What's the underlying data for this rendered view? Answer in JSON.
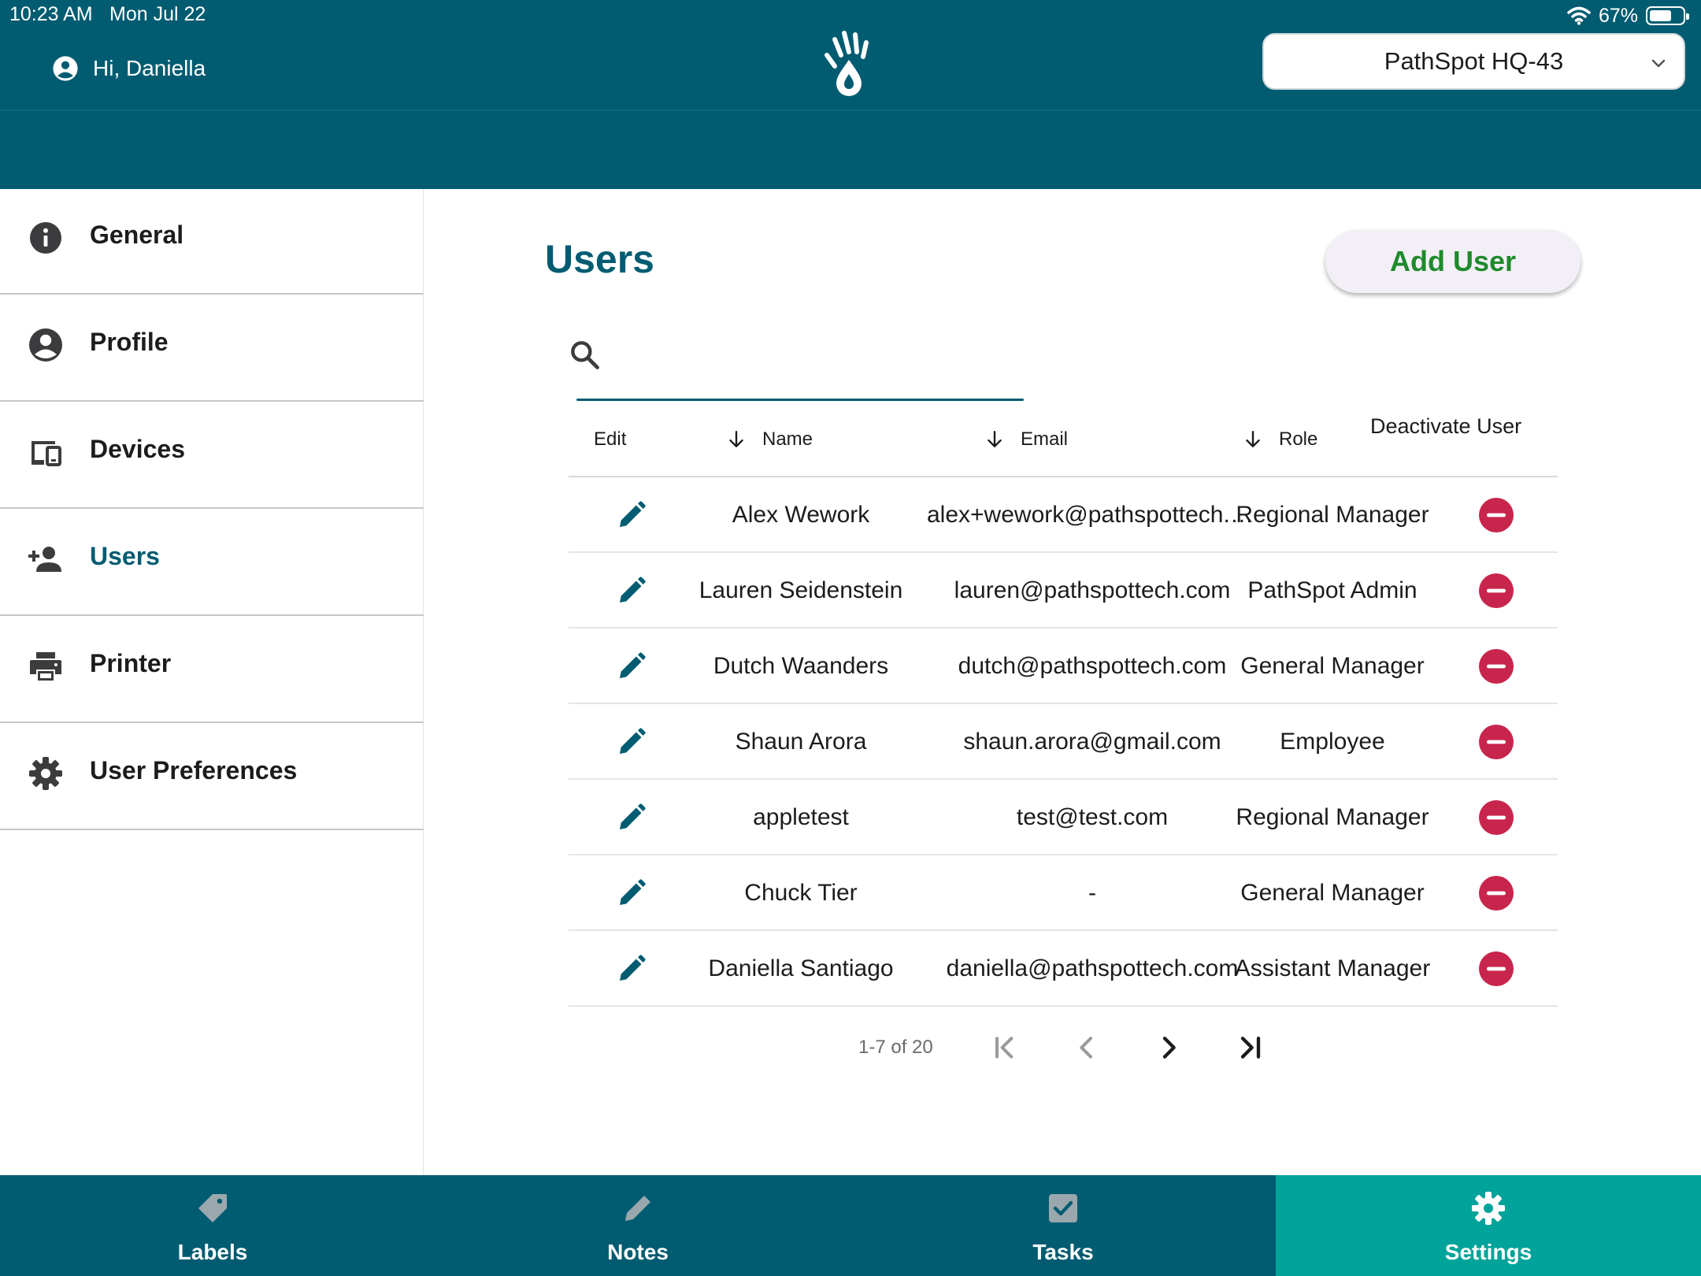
{
  "status_bar": {
    "time": "10:23 AM",
    "date": "Mon Jul 22",
    "battery": "67%",
    "battery_level": 0.67
  },
  "header": {
    "greeting": "Hi, Daniella",
    "location": "PathSpot HQ-43"
  },
  "colors": {
    "primary": "#015c71",
    "accent": "#00a39a",
    "add_user_text": "#1e8a2c",
    "deactivate": "#c8254d"
  },
  "sidebar": {
    "items": [
      {
        "label": "General",
        "icon": "info-icon",
        "active": false
      },
      {
        "label": "Profile",
        "icon": "account-circle-icon",
        "active": false
      },
      {
        "label": "Devices",
        "icon": "devices-icon",
        "active": false
      },
      {
        "label": "Users",
        "icon": "person-add-icon",
        "active": true
      },
      {
        "label": "Printer",
        "icon": "printer-icon",
        "active": false
      },
      {
        "label": "User Preferences",
        "icon": "gear-icon",
        "active": false
      }
    ]
  },
  "main": {
    "title": "Users",
    "add_user_label": "Add User",
    "search": {
      "placeholder": "",
      "value": ""
    },
    "table": {
      "headers": {
        "edit": "Edit",
        "name": "Name",
        "email": "Email",
        "role": "Role",
        "deactivate": "Deactivate User"
      },
      "rows": [
        {
          "name": "Alex Wework",
          "email": "alex+wework@pathspottech.com",
          "role": "Regional Manager"
        },
        {
          "name": "Lauren Seidenstein",
          "email": "lauren@pathspottech.com",
          "role": "PathSpot Admin"
        },
        {
          "name": "Dutch Waanders",
          "email": "dutch@pathspottech.com",
          "role": "General Manager"
        },
        {
          "name": "Shaun Arora",
          "email": "shaun.arora@gmail.com",
          "role": "Employee"
        },
        {
          "name": "appletest",
          "email": "test@test.com",
          "role": "Regional Manager"
        },
        {
          "name": "Chuck Tier",
          "email": "-",
          "role": "General Manager"
        },
        {
          "name": "Daniella Santiago",
          "email": "daniella@pathspottech.com",
          "role": "Assistant Manager"
        }
      ]
    },
    "pagination": {
      "range": "1-7 of 20"
    }
  },
  "bottom_nav": {
    "tabs": [
      {
        "label": "Labels",
        "icon": "tag-icon",
        "active": false
      },
      {
        "label": "Notes",
        "icon": "pencil-icon",
        "active": false
      },
      {
        "label": "Tasks",
        "icon": "checkbox-icon",
        "active": false
      },
      {
        "label": "Settings",
        "icon": "gear-icon",
        "active": true
      }
    ]
  }
}
